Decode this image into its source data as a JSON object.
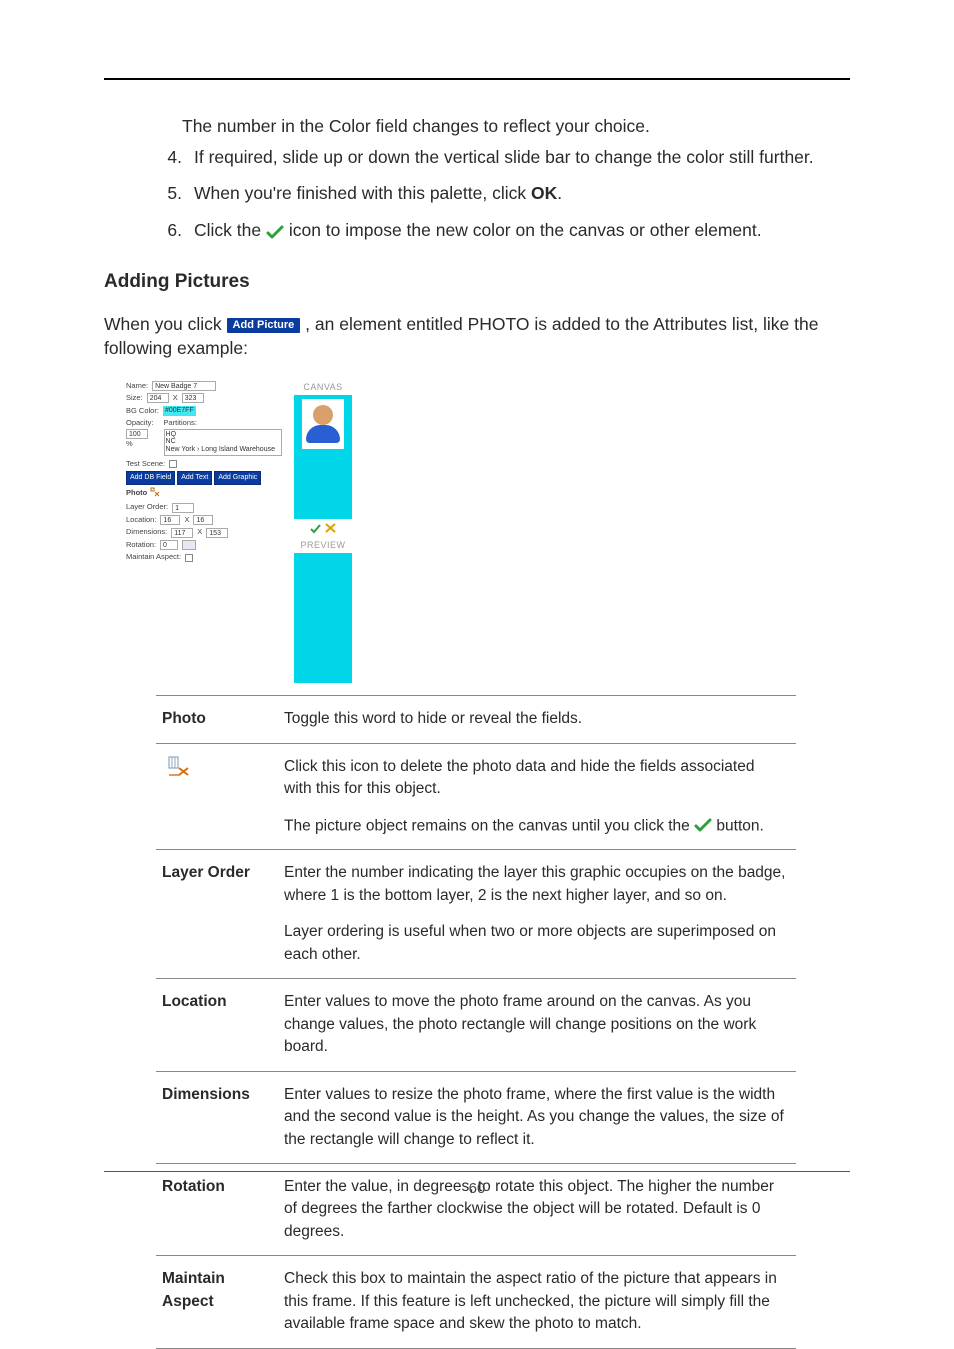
{
  "body": {
    "topSentence": "The number in the Color field changes to reflect your choice.",
    "list": {
      "item4": "If required, slide up or down the vertical slide bar to change the color still further.",
      "item5_pre": "When you're finished with this palette, click ",
      "item5_ok": "OK",
      "item5_post": ".",
      "item6_pre": "Click the ",
      "item6_post": " icon to impose the new color on the canvas or other element."
    },
    "section_heading": "Adding Pictures",
    "intro_pre": "When you click ",
    "intro_btn": "Add Picture",
    "intro_post": ", an element entitled PHOTO is added to the Attributes list, like the following example:"
  },
  "mock": {
    "labels": {
      "name": "Name:",
      "size": "Size:",
      "bgcolor": "BG Color:",
      "opacity": "Opacity:",
      "opacity_pct": "%",
      "partitions": "Partitions:",
      "testscene": "Test Scene:",
      "photo": "Photo",
      "layer": "Layer Order:",
      "location": "Location:",
      "dimensions": "Dimensions:",
      "rotation": "Rotation:",
      "maintain": "Maintain Aspect:"
    },
    "values": {
      "name": "New Badge 7",
      "sizeW": "204",
      "sizeSep": "X",
      "sizeH": "323",
      "bgcolor": "#00E7FF",
      "opacity": "100",
      "part1": "HQ",
      "part2": "NC",
      "part3": "New York › Long Island Warehouse",
      "btn1": "Add DB Field",
      "btn2": "Add Text",
      "btn3": "Add Graphic",
      "layer": "1",
      "locX": "16",
      "locSep": "X",
      "locY": "16",
      "dimW": "117",
      "dimH": "153",
      "rotation": "0"
    },
    "right": {
      "canvas": "CANVAS",
      "preview": "PREVIEW"
    }
  },
  "table": {
    "rows": {
      "photo_key": "Photo",
      "photo_val": "Toggle this word to hide or reveal the fields.",
      "delete_p1": "Click this icon to delete the photo data and hide the fields associated with this for this object.",
      "delete_p2_pre": "The picture object remains on the canvas until you click the ",
      "delete_p2_post": " button.",
      "layer_key": "Layer Order",
      "layer_p1": "Enter the number indicating the layer this graphic occupies on the badge, where 1 is the bottom layer, 2 is the next higher layer, and so on.",
      "layer_p2": "Layer ordering is useful when two or more objects are superimposed on each other.",
      "location_key": "Location",
      "location_val": "Enter values to move the photo frame around on the canvas. As you change values, the photo rectangle will change positions on the work board.",
      "dimensions_key": "Dimensions",
      "dimensions_val": "Enter values to resize the photo frame, where the first value is the width and the second value is the height. As you change the values, the size of the rectangle will change to reflect it.",
      "rotation_key": "Rotation",
      "rotation_val": "Enter the value, in degrees, to rotate this object. The higher the number of degrees the farther clockwise the object will be rotated. Default is 0 degrees.",
      "maintain_key": "Maintain Aspect",
      "maintain_val": "Check this box to maintain the aspect ratio of the picture that appears in this frame. If this feature is left unchecked, the picture will simply fill the available frame space and skew the photo to match."
    }
  },
  "footer": {
    "page": "60"
  }
}
